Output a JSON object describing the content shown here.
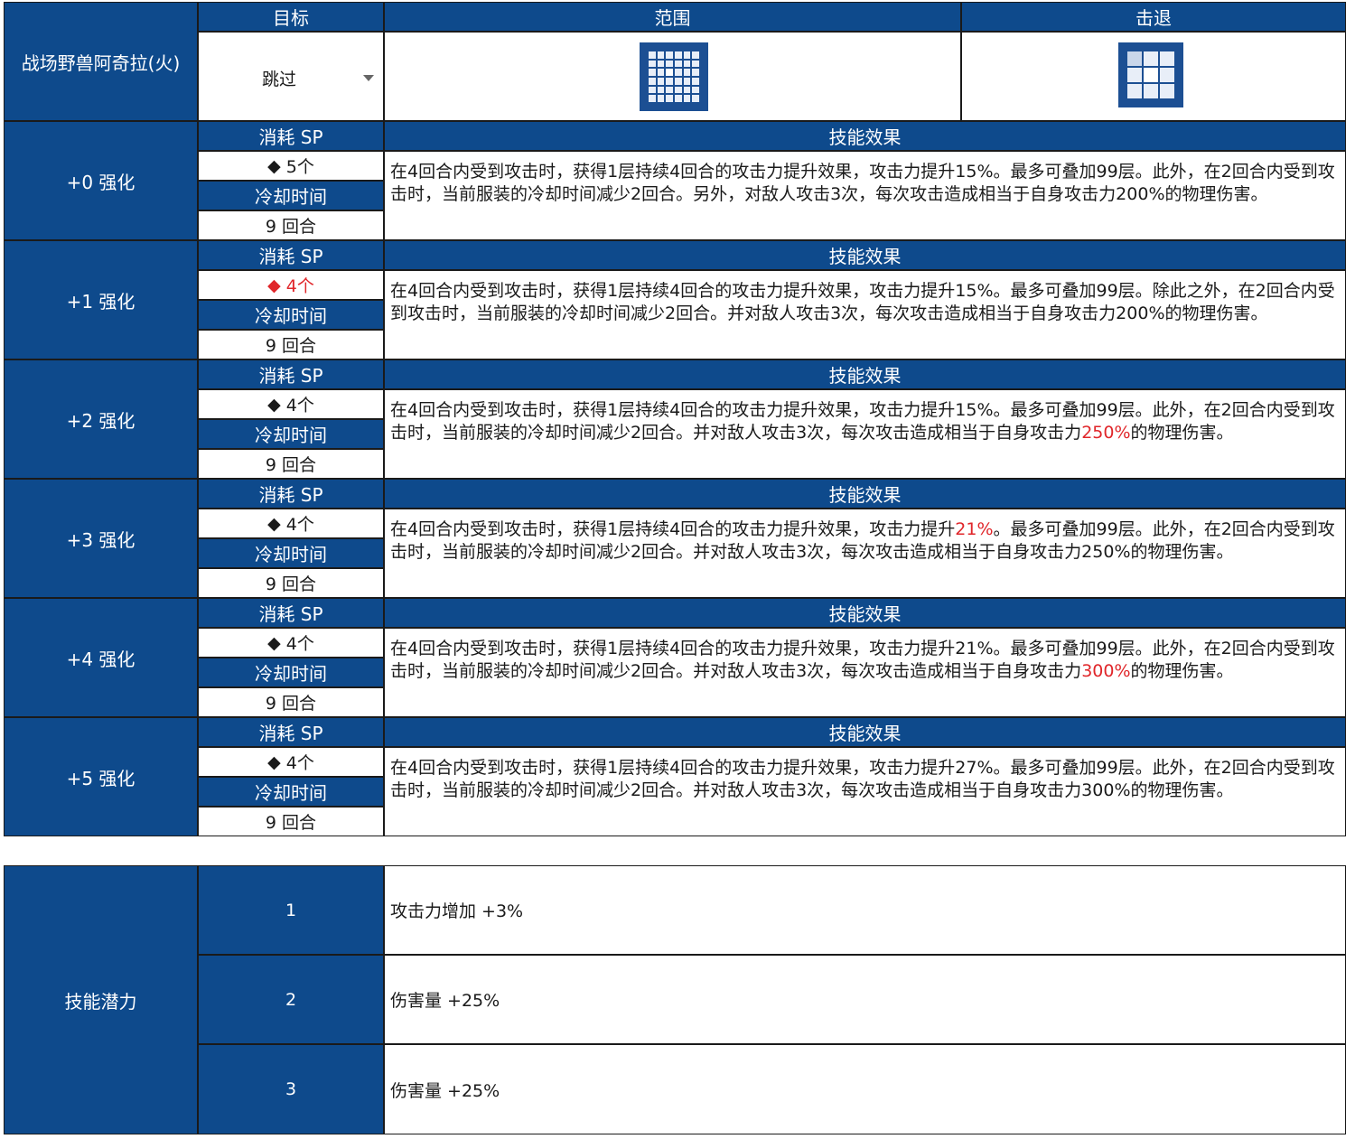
{
  "header": {
    "skill_name": "战场野兽阿奇拉(火)",
    "target_label": "目标",
    "range_label": "范围",
    "knockback_label": "击退",
    "target_value": "跳过",
    "range_icon": "range-grid-icon",
    "knockback_icon": "knockback-grid-icon"
  },
  "labels": {
    "sp": "消耗 SP",
    "cooldown": "冷却时间",
    "effect": "技能效果",
    "diamond": "◆"
  },
  "levels": [
    {
      "name": "+0 强化",
      "sp": "5个",
      "sp_highlight": false,
      "cooldown": "9 回合",
      "effect": [
        {
          "t": "在4回合内受到攻击时，获得1层持续4回合的攻击力提升效果，攻击力提升15%。最多可叠加99层。此外，在2回合内受到攻击时，当前服装的冷却时间减少2回合。另外，对敌人攻击3次，每次攻击造成相当于自身攻击力200%的物理伤害。",
          "red": false
        }
      ]
    },
    {
      "name": "+1 强化",
      "sp": "4个",
      "sp_highlight": true,
      "cooldown": "9 回合",
      "effect": [
        {
          "t": "在4回合内受到攻击时，获得1层持续4回合的攻击力提升效果，攻击力提升15%。最多可叠加99层。除此之外，在2回合内受到攻击时，当前服装的冷却时间减少2回合。并对敌人攻击3次，每次攻击造成相当于自身攻击力200%的物理伤害。",
          "red": false
        }
      ]
    },
    {
      "name": "+2 强化",
      "sp": "4个",
      "sp_highlight": false,
      "cooldown": "9 回合",
      "effect": [
        {
          "t": "在4回合内受到攻击时，获得1层持续4回合的攻击力提升效果，攻击力提升15%。最多可叠加99层。此外，在2回合内受到攻击时，当前服装的冷却时间减少2回合。并对敌人攻击3次，每次攻击造成相当于自身攻击力",
          "red": false
        },
        {
          "t": "250%",
          "red": true
        },
        {
          "t": "的物理伤害。",
          "red": false
        }
      ]
    },
    {
      "name": "+3 强化",
      "sp": "4个",
      "sp_highlight": false,
      "cooldown": "9 回合",
      "effect": [
        {
          "t": "在4回合内受到攻击时，获得1层持续4回合的攻击力提升效果，攻击力提升",
          "red": false
        },
        {
          "t": "21%",
          "red": true
        },
        {
          "t": "。最多可叠加99层。此外，在2回合内受到攻击时，当前服装的冷却时间减少2回合。并对敌人攻击3次，每次攻击造成相当于自身攻击力250%的物理伤害。",
          "red": false
        }
      ]
    },
    {
      "name": "+4 强化",
      "sp": "4个",
      "sp_highlight": false,
      "cooldown": "9 回合",
      "effect": [
        {
          "t": "在4回合内受到攻击时，获得1层持续4回合的攻击力提升效果，攻击力提升21%。最多可叠加99层。此外，在2回合内受到攻击时，当前服装的冷却时间减少2回合。并对敌人攻击3次，每次攻击造成相当于自身攻击力",
          "red": false
        },
        {
          "t": "300%",
          "red": true
        },
        {
          "t": "的物理伤害。",
          "red": false
        }
      ]
    },
    {
      "name": "+5 强化",
      "sp": "4个",
      "sp_highlight": false,
      "cooldown": "9 回合",
      "effect": [
        {
          "t": "在4回合内受到攻击时，获得1层持续4回合的攻击力提升效果，攻击力提升27%。最多可叠加99层。此外，在2回合内受到攻击时，当前服装的冷却时间减少2回合。并对敌人攻击3次，每次攻击造成相当于自身攻击力300%的物理伤害。",
          "red": false
        }
      ]
    }
  ],
  "potential": {
    "label": "技能潜力",
    "rows": [
      {
        "num": "1",
        "text": "攻击力增加 +3%"
      },
      {
        "num": "2",
        "text": "伤害量 +25%"
      },
      {
        "num": "3",
        "text": "伤害量 +25%"
      }
    ]
  },
  "colors": {
    "header_blue": "#0e4a8c",
    "highlight_red": "#e0262a"
  }
}
